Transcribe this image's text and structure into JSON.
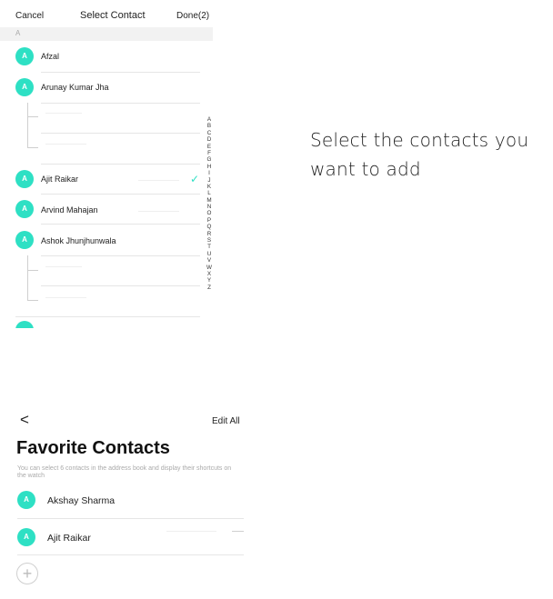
{
  "top": {
    "cancel_label": "Cancel",
    "title": "Select Contact",
    "done_label": "Done(2)",
    "section_letter": "A",
    "contacts": [
      {
        "initial": "A",
        "name": "Afzal"
      },
      {
        "initial": "A",
        "name": "Arunay Kumar Jha"
      },
      {
        "initial": "A",
        "name": "Ajit Raikar",
        "selected": true
      },
      {
        "initial": "A",
        "name": "Arvind Mahajan"
      },
      {
        "initial": "A",
        "name": "Ashok Jhunjhunwala"
      }
    ],
    "check_icon": "✓",
    "alphabet": [
      "A",
      "B",
      "C",
      "D",
      "E",
      "F",
      "G",
      "H",
      "I",
      "J",
      "K",
      "L",
      "M",
      "N",
      "O",
      "P",
      "Q",
      "R",
      "S",
      "T",
      "U",
      "V",
      "W",
      "X",
      "Y",
      "Z"
    ]
  },
  "caption": {
    "line1": "Select the contacts you",
    "line2": "want to add"
  },
  "bottom": {
    "back_icon": "<",
    "edit_all_label": "Edit All",
    "title": "Favorite Contacts",
    "description": "You can select 6 contacts in the address book and display their shortcuts on the watch",
    "favorites": [
      {
        "initial": "A",
        "name": "Akshay Sharma"
      },
      {
        "initial": "A",
        "name": "Ajit Raikar"
      }
    ],
    "add_icon": "+"
  },
  "colors": {
    "accent": "#2ee0c4",
    "section_band": "#f2f2f2"
  }
}
